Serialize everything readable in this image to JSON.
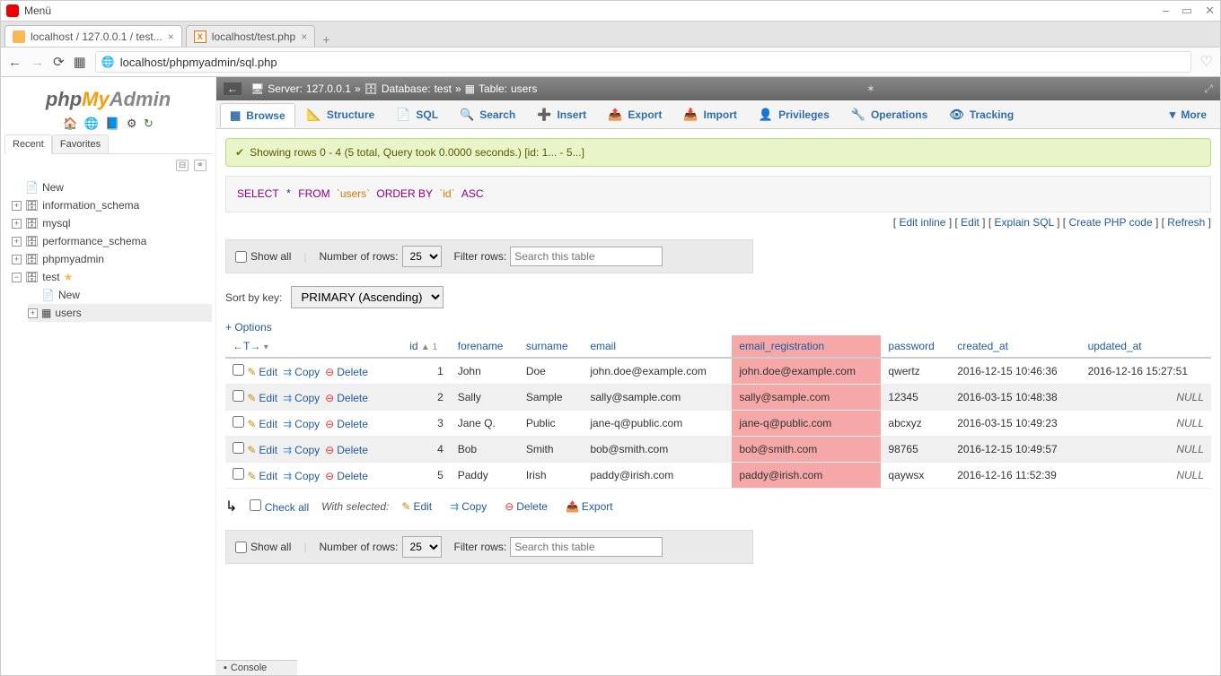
{
  "browser": {
    "menu": "Menü",
    "tabs": [
      {
        "title": "localhost / 127.0.0.1 / test..."
      },
      {
        "title": "localhost/test.php"
      }
    ],
    "url": "localhost/phpmyadmin/sql.php"
  },
  "sidebar": {
    "logo": {
      "php": "php",
      "my": "My",
      "admin": "Admin"
    },
    "tabs": {
      "recent": "Recent",
      "favorites": "Favorites"
    },
    "tree": {
      "new": "New",
      "dbs": [
        "information_schema",
        "mysql",
        "performance_schema",
        "phpmyadmin"
      ],
      "test": "test",
      "test_new": "New",
      "users": "users"
    }
  },
  "breadcrumb": {
    "server_label": "Server:",
    "server": "127.0.0.1",
    "database_label": "Database:",
    "database": "test",
    "table_label": "Table:",
    "table": "users"
  },
  "tabs": {
    "browse": "Browse",
    "structure": "Structure",
    "sql": "SQL",
    "search": "Search",
    "insert": "Insert",
    "export": "Export",
    "import": "Import",
    "privileges": "Privileges",
    "operations": "Operations",
    "tracking": "Tracking",
    "more": "More"
  },
  "status": "Showing rows 0 - 4 (5 total, Query took 0.0000 seconds.) [id: 1... - 5...]",
  "sql": "SELECT * FROM `users` ORDER BY `id` ASC",
  "sql_links": {
    "inline": "Edit inline",
    "edit": "Edit",
    "explain": "Explain SQL",
    "php": "Create PHP code",
    "refresh": "Refresh"
  },
  "controls": {
    "show_all": "Show all",
    "num_rows_label": "Number of rows:",
    "num_rows": "25",
    "filter_label": "Filter rows:",
    "filter_placeholder": "Search this table"
  },
  "sortkey": {
    "label": "Sort by key:",
    "value": "PRIMARY (Ascending)"
  },
  "options": "+ Options",
  "columns": {
    "t": "←T→",
    "id": "id",
    "id_sort": "▲ 1",
    "forename": "forename",
    "surname": "surname",
    "email": "email",
    "email_reg": "email_registration",
    "password": "password",
    "created": "created_at",
    "updated": "updated_at"
  },
  "row_actions": {
    "edit": "Edit",
    "copy": "Copy",
    "delete": "Delete"
  },
  "rows": [
    {
      "id": "1",
      "forename": "John",
      "surname": "Doe",
      "email": "john.doe@example.com",
      "email_reg": "john.doe@example.com",
      "password": "qwertz",
      "created": "2016-12-15 10:46:36",
      "updated": "2016-12-16 15:27:51"
    },
    {
      "id": "2",
      "forename": "Sally",
      "surname": "Sample",
      "email": "sally@sample.com",
      "email_reg": "sally@sample.com",
      "password": "12345",
      "created": "2016-03-15 10:48:38",
      "updated": "NULL"
    },
    {
      "id": "3",
      "forename": "Jane Q.",
      "surname": "Public",
      "email": "jane-q@public.com",
      "email_reg": "jane-q@public.com",
      "password": "abcxyz",
      "created": "2016-03-15 10:49:23",
      "updated": "NULL"
    },
    {
      "id": "4",
      "forename": "Bob",
      "surname": "Smith",
      "email": "bob@smith.com",
      "email_reg": "bob@smith.com",
      "password": "98765",
      "created": "2016-12-15 10:49:57",
      "updated": "NULL"
    },
    {
      "id": "5",
      "forename": "Paddy",
      "surname": "Irish",
      "email": "paddy@irish.com",
      "email_reg": "paddy@irish.com",
      "password": "qaywsx",
      "created": "2016-12-16 11:52:39",
      "updated": "NULL"
    }
  ],
  "footer": {
    "check_all": "Check all",
    "with_selected": "With selected:",
    "edit": "Edit",
    "copy": "Copy",
    "delete": "Delete",
    "export": "Export"
  },
  "console": "Console"
}
